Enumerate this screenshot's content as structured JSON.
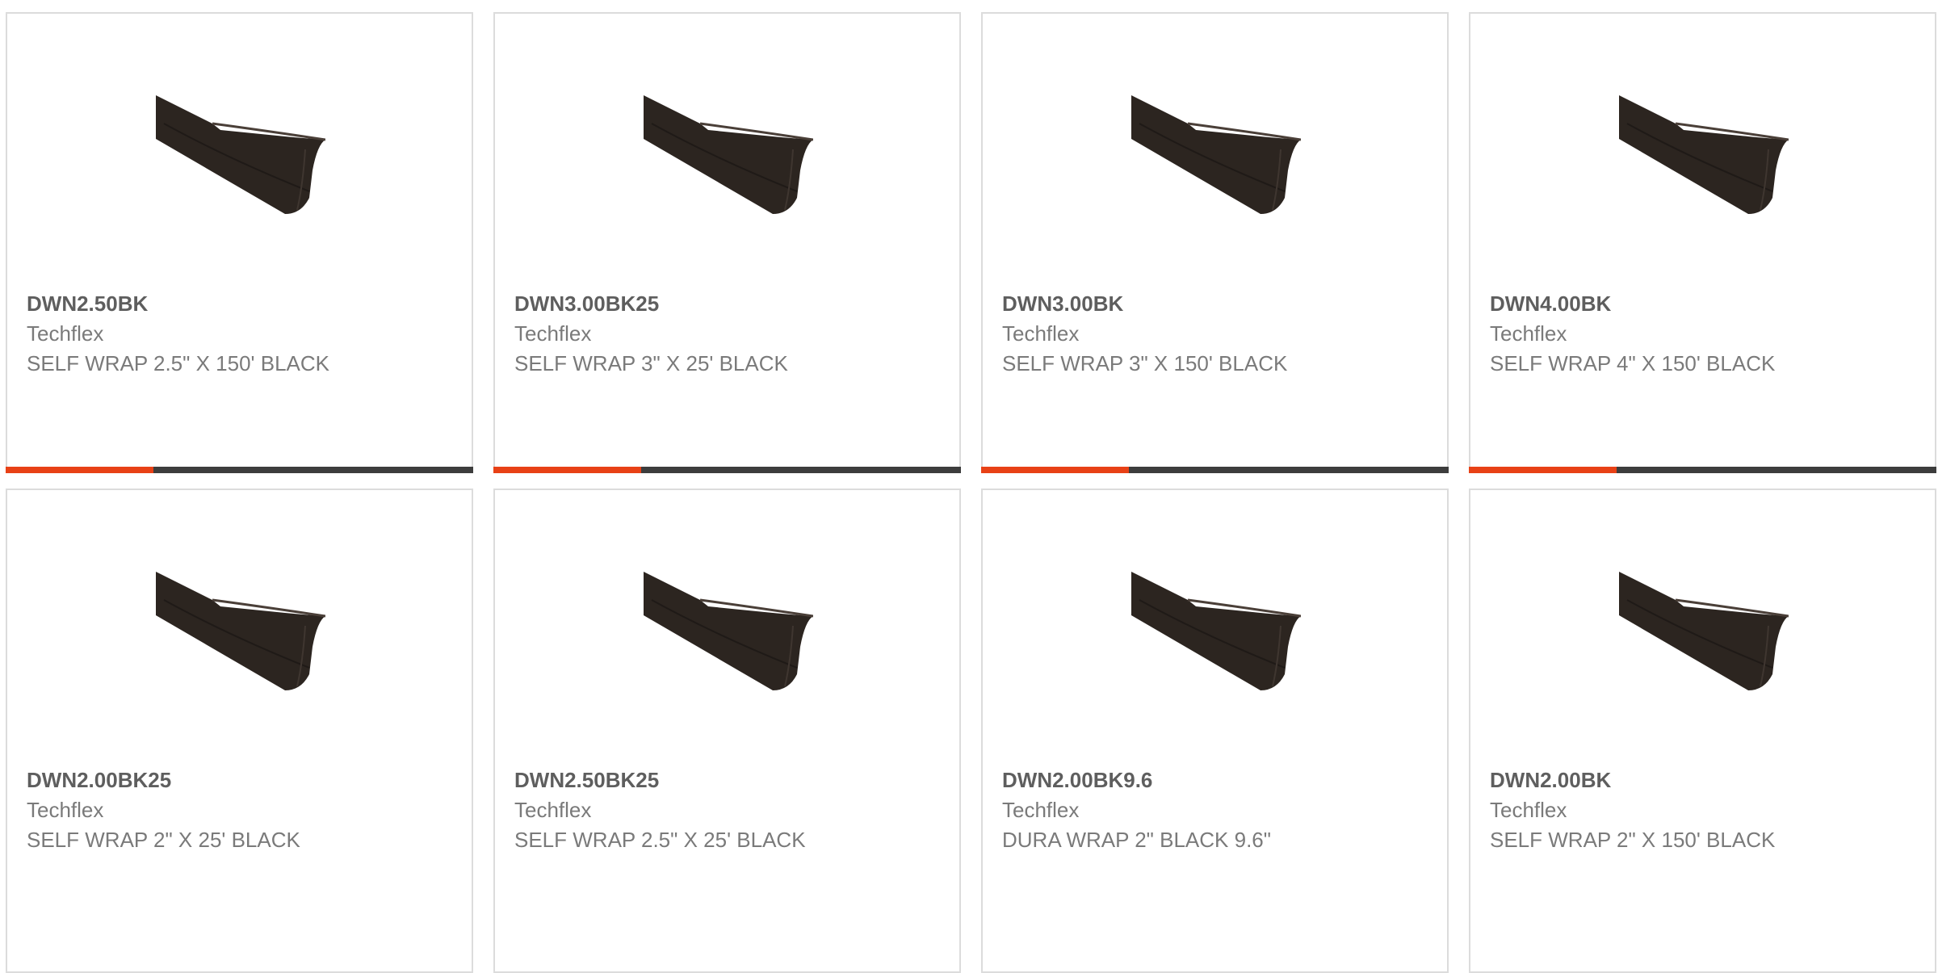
{
  "colors": {
    "accent": "#e84116",
    "bar_dark": "#3d3d3d",
    "card_border": "#dcdcdc",
    "part_text": "#5e5e5e",
    "body_text": "#7a7a7a"
  },
  "products": [
    {
      "part": "DWN2.50BK",
      "brand": "Techflex",
      "desc": "SELF WRAP 2.5\" X 150' BLACK",
      "image": "self-wrap-sleeve-black"
    },
    {
      "part": "DWN3.00BK25",
      "brand": "Techflex",
      "desc": "SELF WRAP 3\" X 25' BLACK",
      "image": "self-wrap-sleeve-black"
    },
    {
      "part": "DWN3.00BK",
      "brand": "Techflex",
      "desc": "SELF WRAP 3\" X 150' BLACK",
      "image": "self-wrap-sleeve-black"
    },
    {
      "part": "DWN4.00BK",
      "brand": "Techflex",
      "desc": "SELF WRAP 4\" X 150' BLACK",
      "image": "self-wrap-sleeve-black"
    },
    {
      "part": "DWN2.00BK25",
      "brand": "Techflex",
      "desc": "SELF WRAP 2\" X 25' BLACK",
      "image": "self-wrap-sleeve-black"
    },
    {
      "part": "DWN2.50BK25",
      "brand": "Techflex",
      "desc": "SELF WRAP 2.5\" X 25' BLACK",
      "image": "self-wrap-sleeve-black"
    },
    {
      "part": "DWN2.00BK9.6",
      "brand": "Techflex",
      "desc": "DURA WRAP 2\" BLACK 9.6\"",
      "image": "self-wrap-sleeve-black"
    },
    {
      "part": "DWN2.00BK",
      "brand": "Techflex",
      "desc": "SELF WRAP 2\" X 150' BLACK",
      "image": "self-wrap-sleeve-black"
    }
  ]
}
